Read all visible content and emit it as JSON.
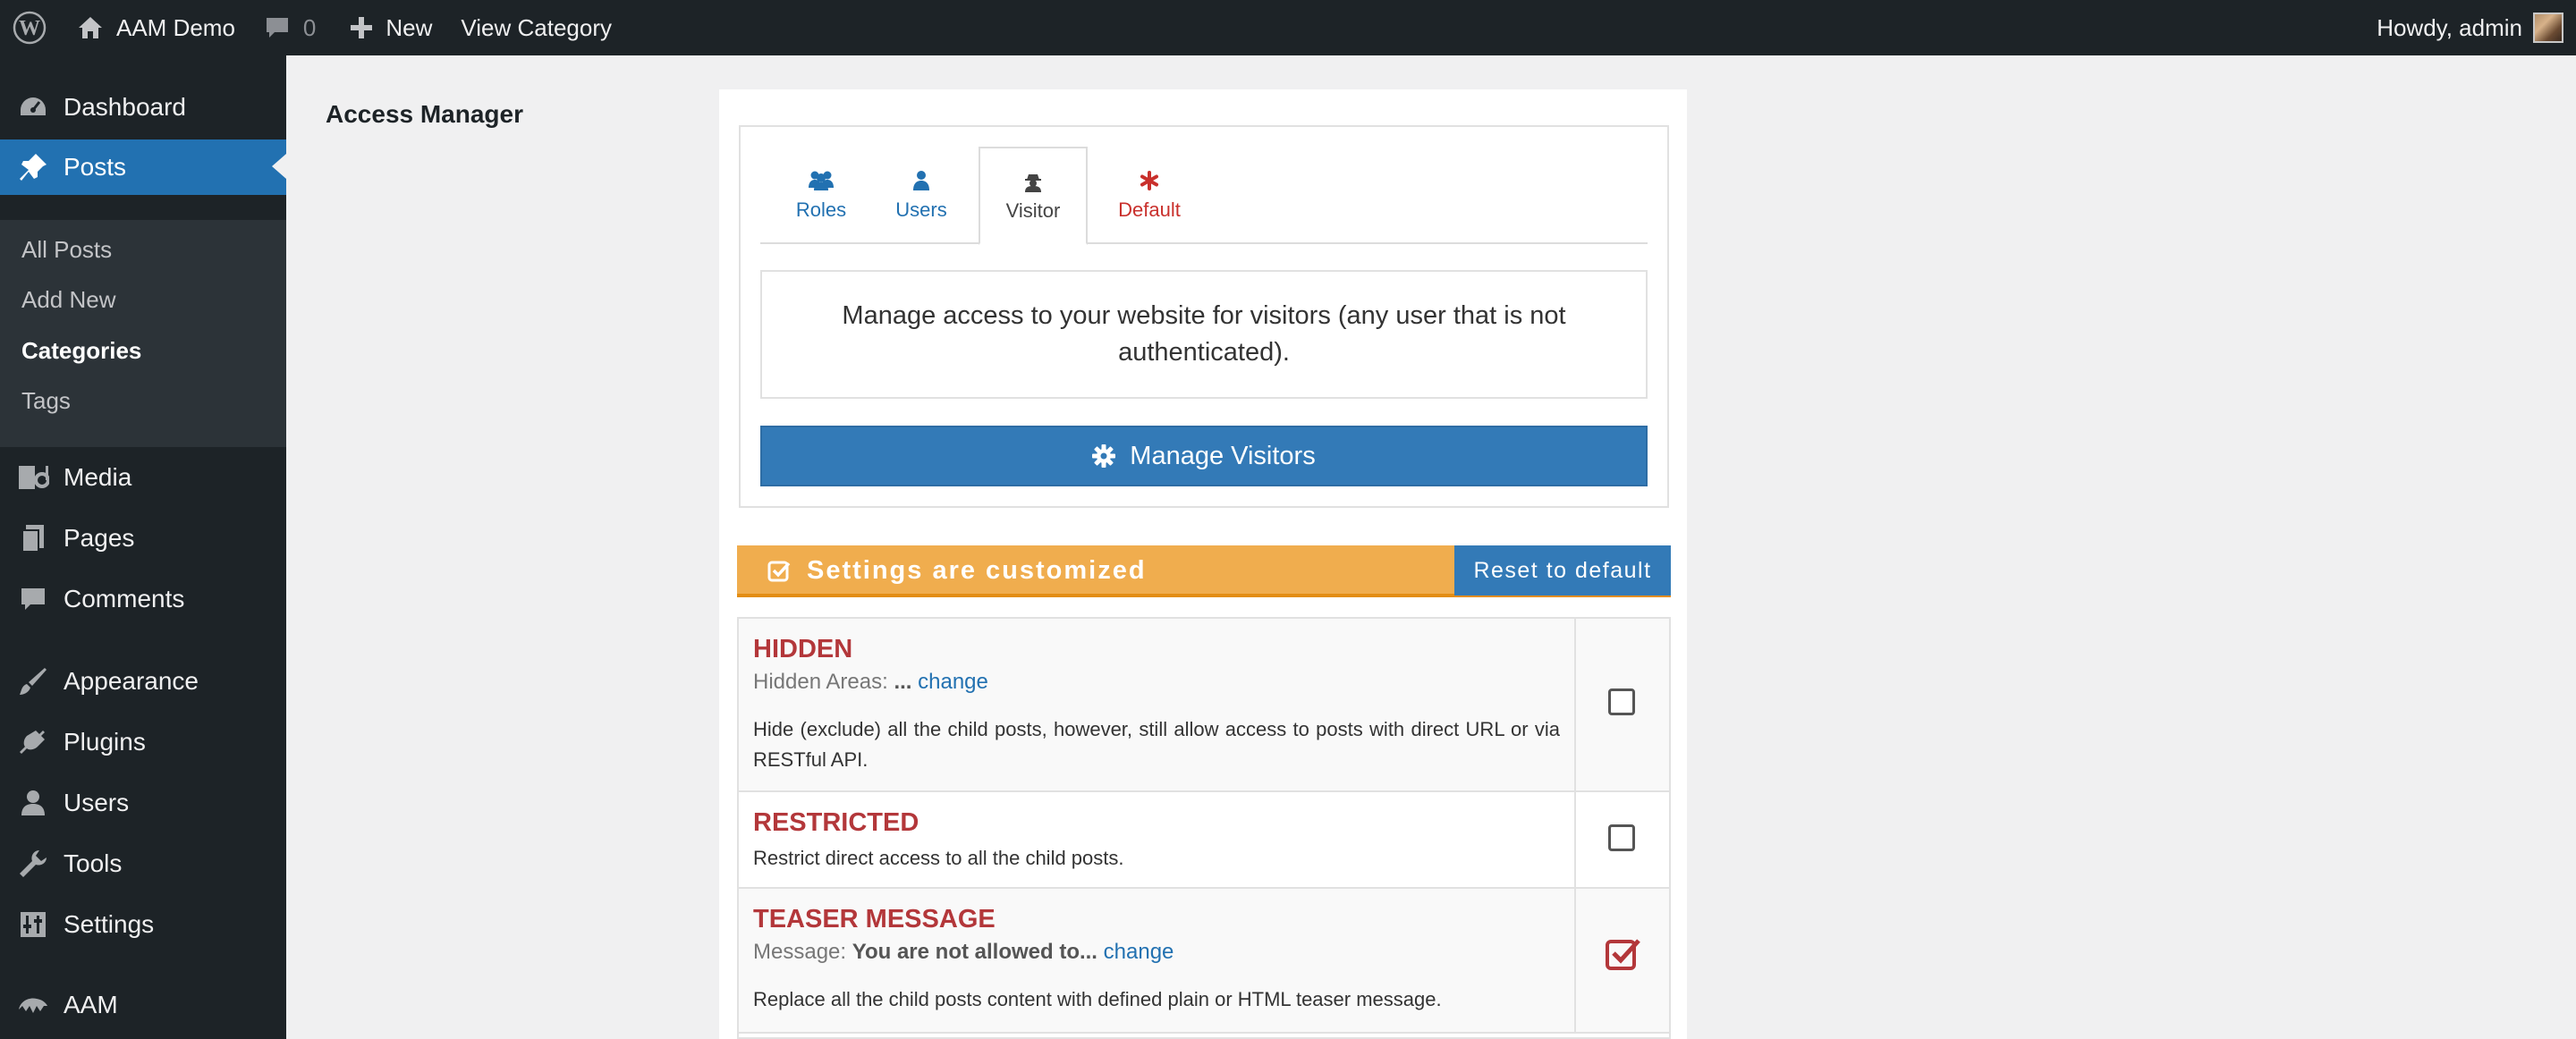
{
  "adminbar": {
    "site_name": "AAM Demo",
    "comment_count": "0",
    "new_label": "New",
    "view_category_label": "View Category",
    "howdy": "Howdy, admin"
  },
  "sidebar": {
    "items": [
      {
        "label": "Dashboard",
        "icon": "dashboard-icon"
      },
      {
        "label": "Posts",
        "icon": "pin-icon",
        "current": true
      },
      {
        "label": "Media",
        "icon": "media-icon"
      },
      {
        "label": "Pages",
        "icon": "pages-icon"
      },
      {
        "label": "Comments",
        "icon": "comment-icon"
      },
      {
        "label": "Appearance",
        "icon": "brush-icon"
      },
      {
        "label": "Plugins",
        "icon": "plug-icon"
      },
      {
        "label": "Users",
        "icon": "user-icon"
      },
      {
        "label": "Tools",
        "icon": "wrench-icon"
      },
      {
        "label": "Settings",
        "icon": "settings-icon"
      },
      {
        "label": "AAM",
        "icon": "aam-icon"
      }
    ],
    "submenu": [
      {
        "label": "All Posts"
      },
      {
        "label": "Add New"
      },
      {
        "label": "Categories",
        "current": true
      },
      {
        "label": "Tags"
      }
    ]
  },
  "page": {
    "title": "Access Manager"
  },
  "aam": {
    "tabs": [
      {
        "label": "Roles",
        "icon": "users-group-icon"
      },
      {
        "label": "Users",
        "icon": "user-icon"
      },
      {
        "label": "Visitor",
        "icon": "visitor-icon",
        "active": true
      },
      {
        "label": "Default",
        "icon": "asterisk-icon"
      }
    ],
    "visitor_description": "Manage access to your website for visitors (any user that is not authenticated).",
    "manage_button": "Manage Visitors",
    "settings_status": "Settings are customized",
    "reset_button": "Reset to default",
    "options": [
      {
        "title": "HIDDEN",
        "meta_label": "Hidden Areas:",
        "meta_value": "...",
        "meta_link": "change",
        "description": "Hide (exclude) all the child posts, however, still allow access to posts with direct URL or via RESTful API.",
        "checked": false
      },
      {
        "title": "RESTRICTED",
        "description": "Restrict direct access to all the child posts.",
        "checked": false
      },
      {
        "title": "TEASER MESSAGE",
        "meta_label": "Message:",
        "meta_value": "You are not allowed to...",
        "meta_link": "change",
        "description": "Replace all the child posts content with defined plain or HTML teaser message.",
        "checked": true
      }
    ]
  },
  "colors": {
    "admin_dark": "#1d2327",
    "wp_blue": "#2271b1",
    "aam_blue": "#337ab7",
    "warning_orange": "#f0ad4e",
    "option_red": "#b3373a"
  }
}
